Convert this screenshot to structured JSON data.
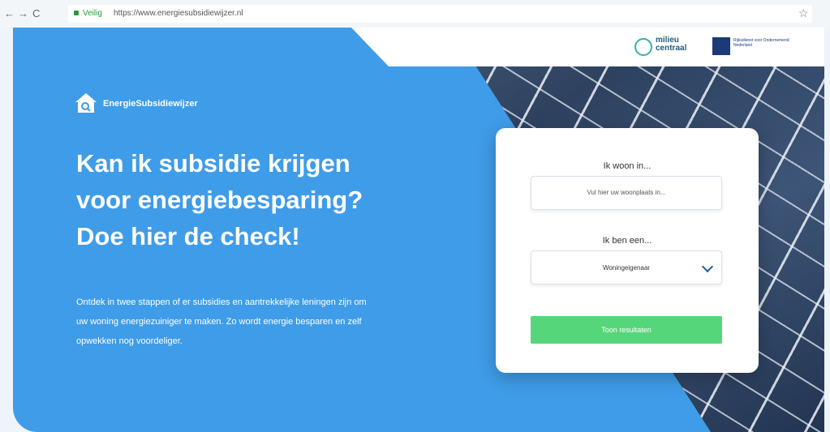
{
  "browser": {
    "back_glyph": "←",
    "forward_glyph": "→",
    "reload_glyph": "C",
    "secure_label": "Veilig",
    "url": "https://www.energiesubsidiewijzer.nl",
    "bookmark_glyph": "☆"
  },
  "header": {
    "milieu_line1": "milieu",
    "milieu_line2": "centraal",
    "rijks_line1": "Rijksdienst voor Ondernemend",
    "rijks_line2": "Nederland"
  },
  "brand": {
    "name": "EnergieSubsidiewijzer",
    "icon": "house-search-icon"
  },
  "hero": {
    "title_line1": "Kan ik subsidie krijgen",
    "title_line2": "voor energiebesparing?",
    "title_line3": "Doe hier de check!",
    "intro_line1": "Ontdek in twee stappen of er subsidies en aantrekkelijke leningen zijn om",
    "intro_line2": "uw woning energiezuiniger te maken. Zo wordt energie besparen en zelf",
    "intro_line3": "opwekken nog voordeliger."
  },
  "form": {
    "location_label": "Ik woon in...",
    "location_placeholder": "Vul hier uw woonplaats in...",
    "role_label": "Ik ben een...",
    "role_value": "Woningeigenaar",
    "submit_label": "Toon resultaten"
  },
  "colors": {
    "hero_blue": "#3f9ce8",
    "button_green": "#56d67a",
    "secure_green": "#2a9a3c"
  }
}
